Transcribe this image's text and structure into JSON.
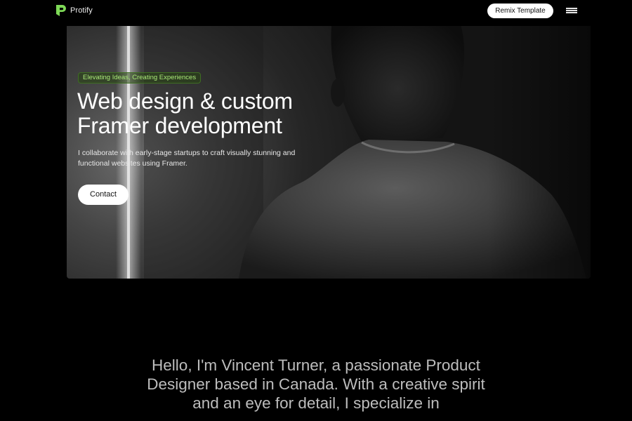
{
  "header": {
    "brand_name": "Protify",
    "brand_color": "#7ed957",
    "remix_label": "Remix Template",
    "menu_icon": "hamburger-menu-icon"
  },
  "hero": {
    "tagline": "Elevating Ideas, Creating Experiences",
    "title_line1": "Web design & custom",
    "title_line2": "Framer development",
    "description": "I collaborate with early-stage startups to craft visually stunning and functional websites using Framer.",
    "contact_label": "Contact",
    "tagline_color": "#a9e878"
  },
  "intro": {
    "text": "Hello, I'm Vincent Turner, a passionate Product Designer based in Canada. With a creative spirit and an eye for detail, I specialize in"
  }
}
